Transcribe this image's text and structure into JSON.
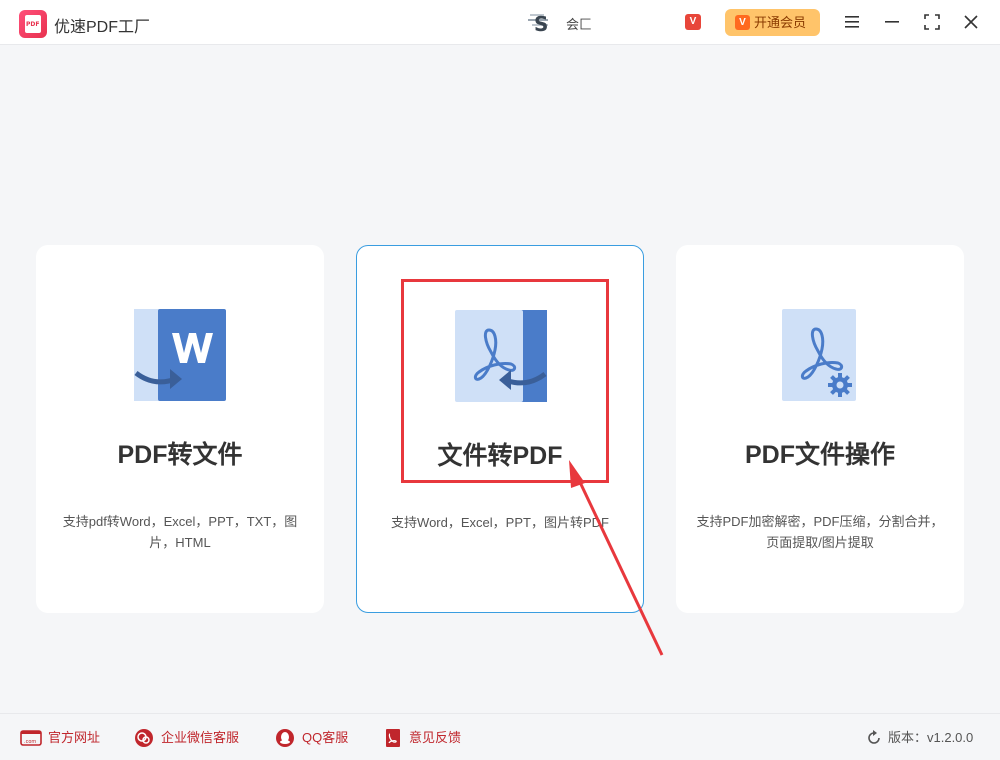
{
  "app": {
    "title": "优速PDF工厂",
    "logo_text": "PDF"
  },
  "header": {
    "user_name": "会匚",
    "vip_badge_text": "V",
    "vip_button_label": "开通会员",
    "vip_button_icon_text": "V"
  },
  "cards": [
    {
      "title": "PDF转文件",
      "description": "支持pdf转Word，Excel，PPT，TXT，图片，HTML",
      "icon": "pdf-to-word-icon"
    },
    {
      "title": "文件转PDF",
      "description": "支持Word，Excel，PPT，图片转PDF",
      "icon": "file-to-pdf-icon"
    },
    {
      "title": "PDF文件操作",
      "description": "支持PDF加密解密，PDF压缩，分割合并，页面提取/图片提取",
      "icon": "pdf-settings-icon"
    }
  ],
  "footer": {
    "links": [
      {
        "label": "官方网址",
        "icon": "website-icon"
      },
      {
        "label": "企业微信客服",
        "icon": "wechat-service-icon"
      },
      {
        "label": "QQ客服",
        "icon": "qq-icon"
      },
      {
        "label": "意见反馈",
        "icon": "feedback-icon"
      }
    ],
    "version": "版本：v1.2.0.0"
  },
  "colors": {
    "accent": "#4a7cc9",
    "icon_light": "#cfe0f7",
    "brand": "#e8324f",
    "vip": "#ffc46a",
    "annotation": "#e8383d",
    "footer_link": "#c0262c"
  }
}
